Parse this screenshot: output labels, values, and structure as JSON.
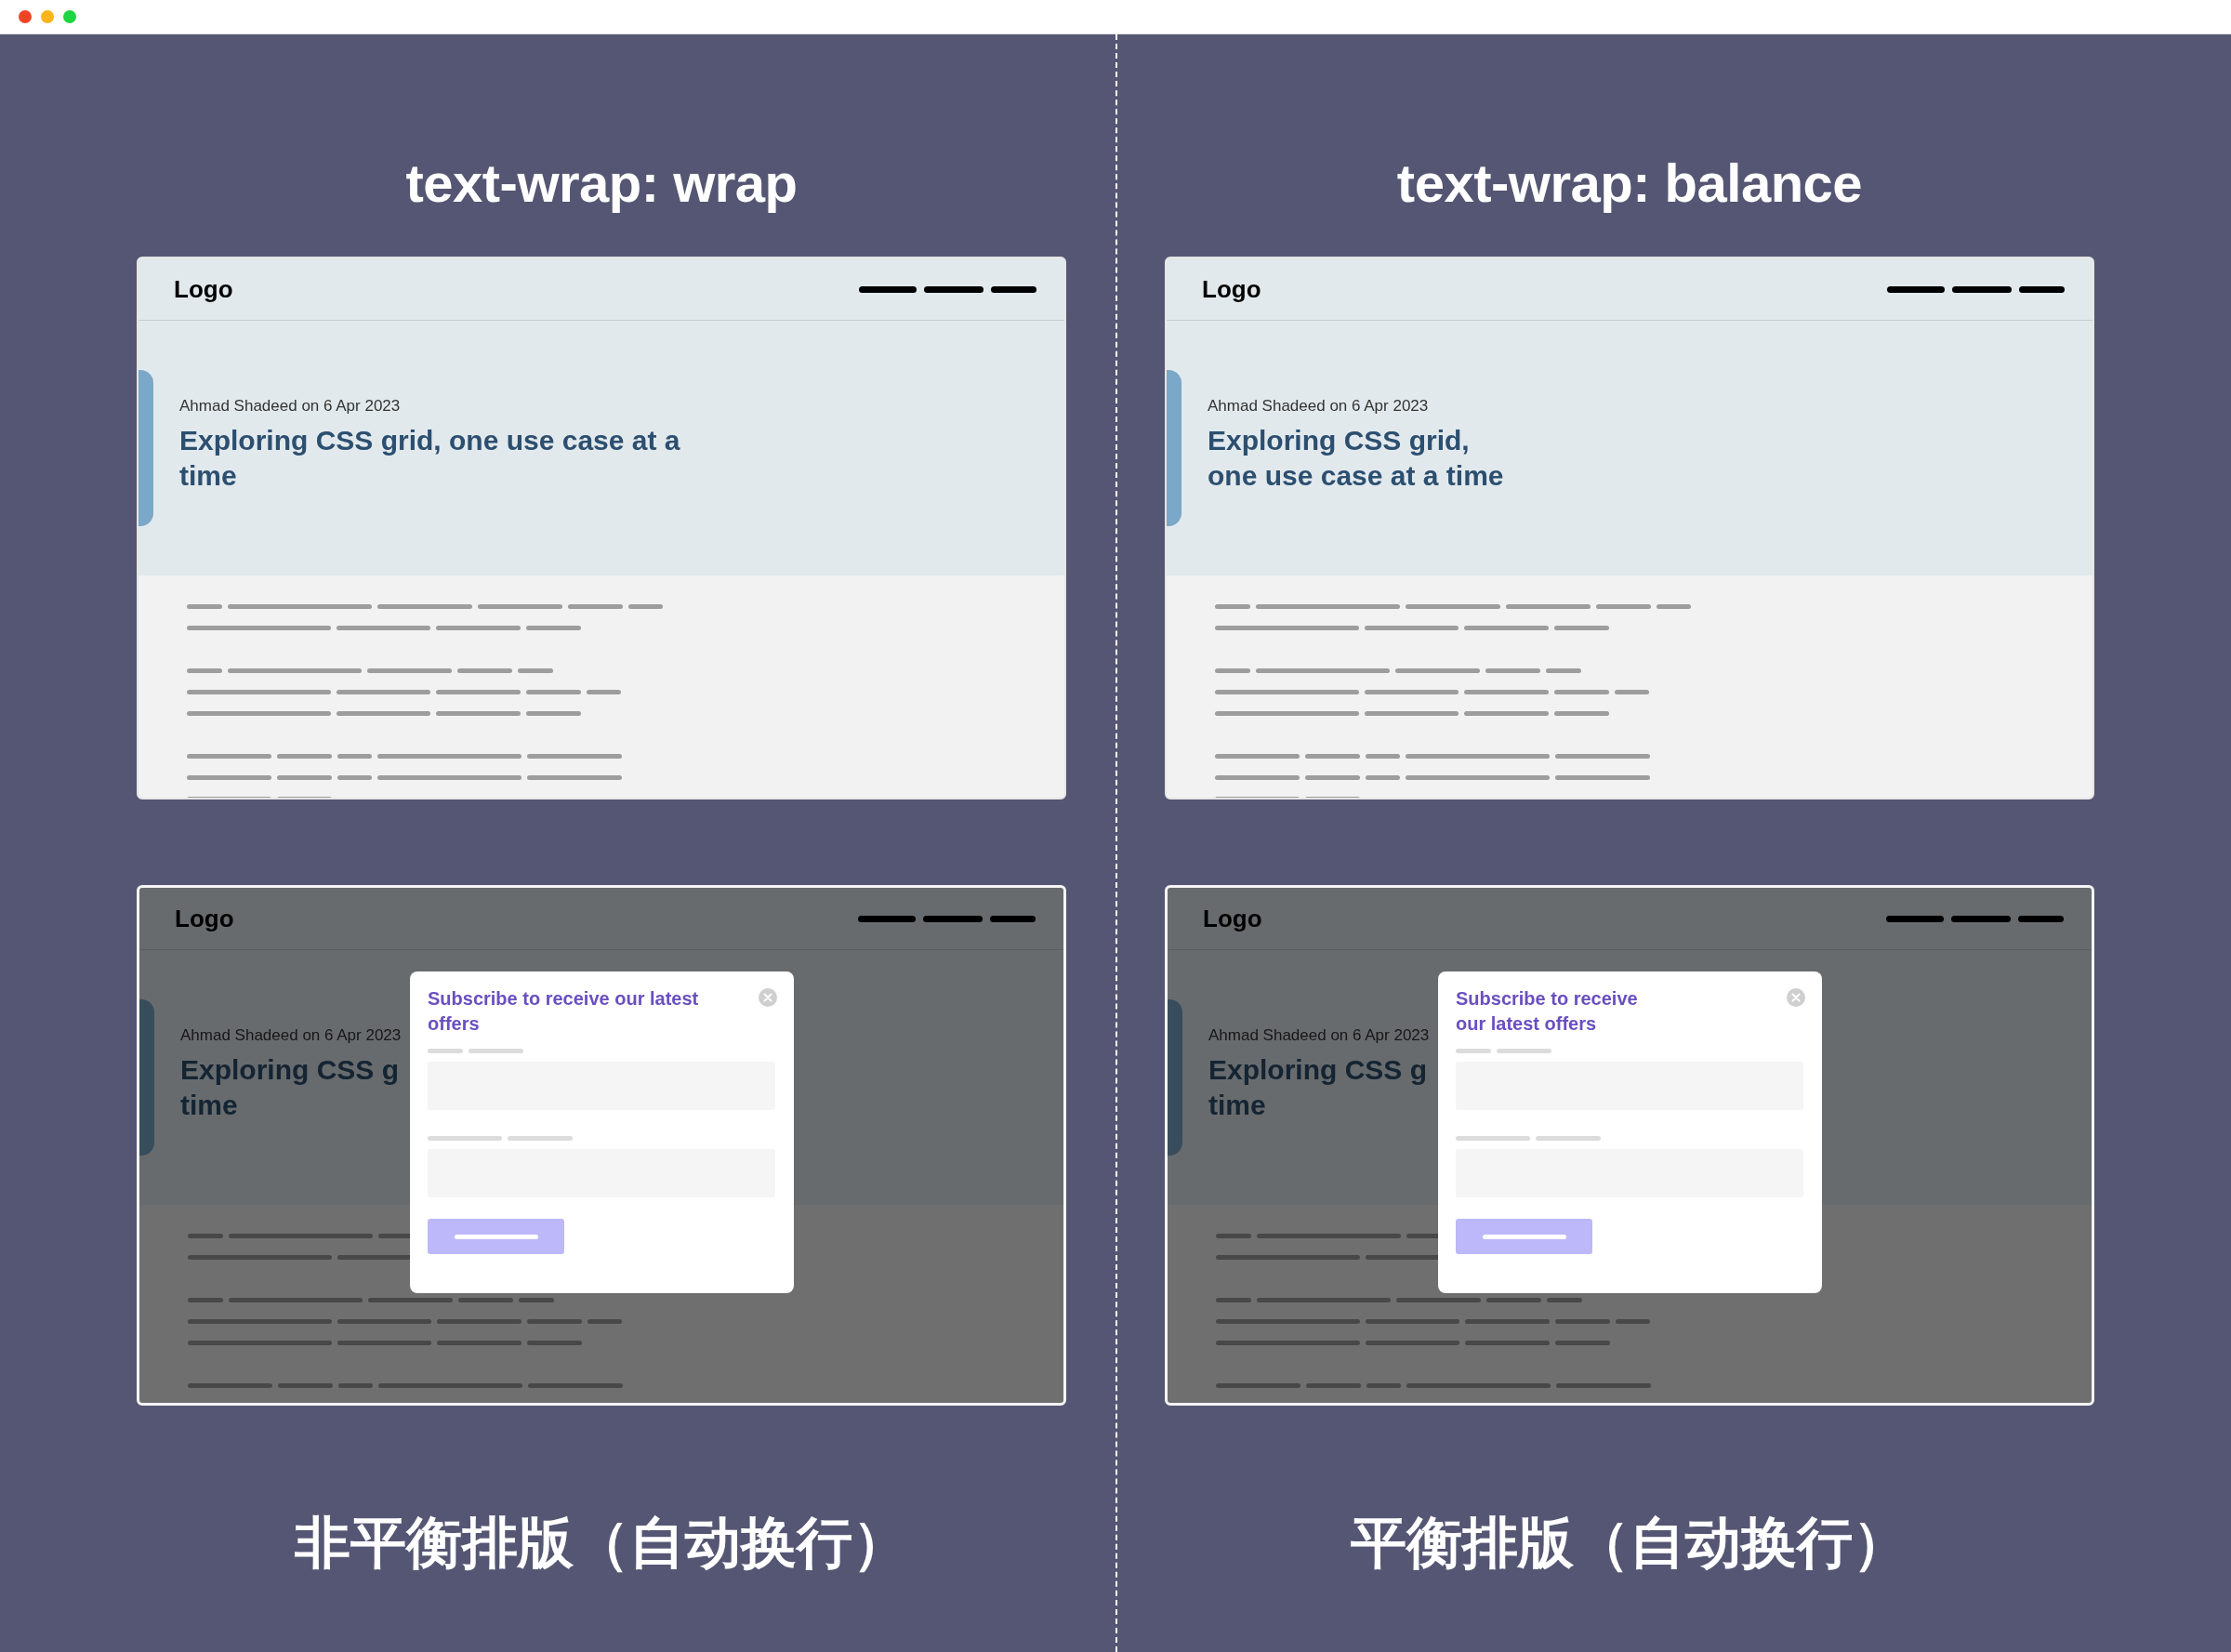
{
  "panels": [
    {
      "heading": "text-wrap: wrap",
      "kind": "wrap",
      "cards": [
        {
          "kind": "page",
          "logo": "Logo",
          "meta": "Ahmad Shadeed on 6 Apr 2023",
          "title_lines": [
            "Exploring CSS grid, one use case at a time"
          ]
        },
        {
          "kind": "dialog",
          "logo": "Logo",
          "meta": "Ahmad Shadeed on 6 Apr 2023",
          "title_lines": [
            "Exploring CSS g",
            "time"
          ],
          "dialog_title": "Subscribe to receive our latest offers"
        }
      ],
      "caption": "非平衡排版（自动换行）"
    },
    {
      "heading": "text-wrap: balance",
      "kind": "balance",
      "cards": [
        {
          "kind": "page",
          "logo": "Logo",
          "meta": "Ahmad Shadeed on 6 Apr 2023",
          "title_lines": [
            "Exploring CSS grid, one use case at a time"
          ]
        },
        {
          "kind": "dialog",
          "logo": "Logo",
          "meta": "Ahmad Shadeed on 6 Apr 2023",
          "title_lines": [
            "Exploring CSS g",
            "time"
          ],
          "dialog_title": "Subscribe to receive our latest offers"
        }
      ],
      "caption": "平衡排版（自动换行）"
    }
  ]
}
